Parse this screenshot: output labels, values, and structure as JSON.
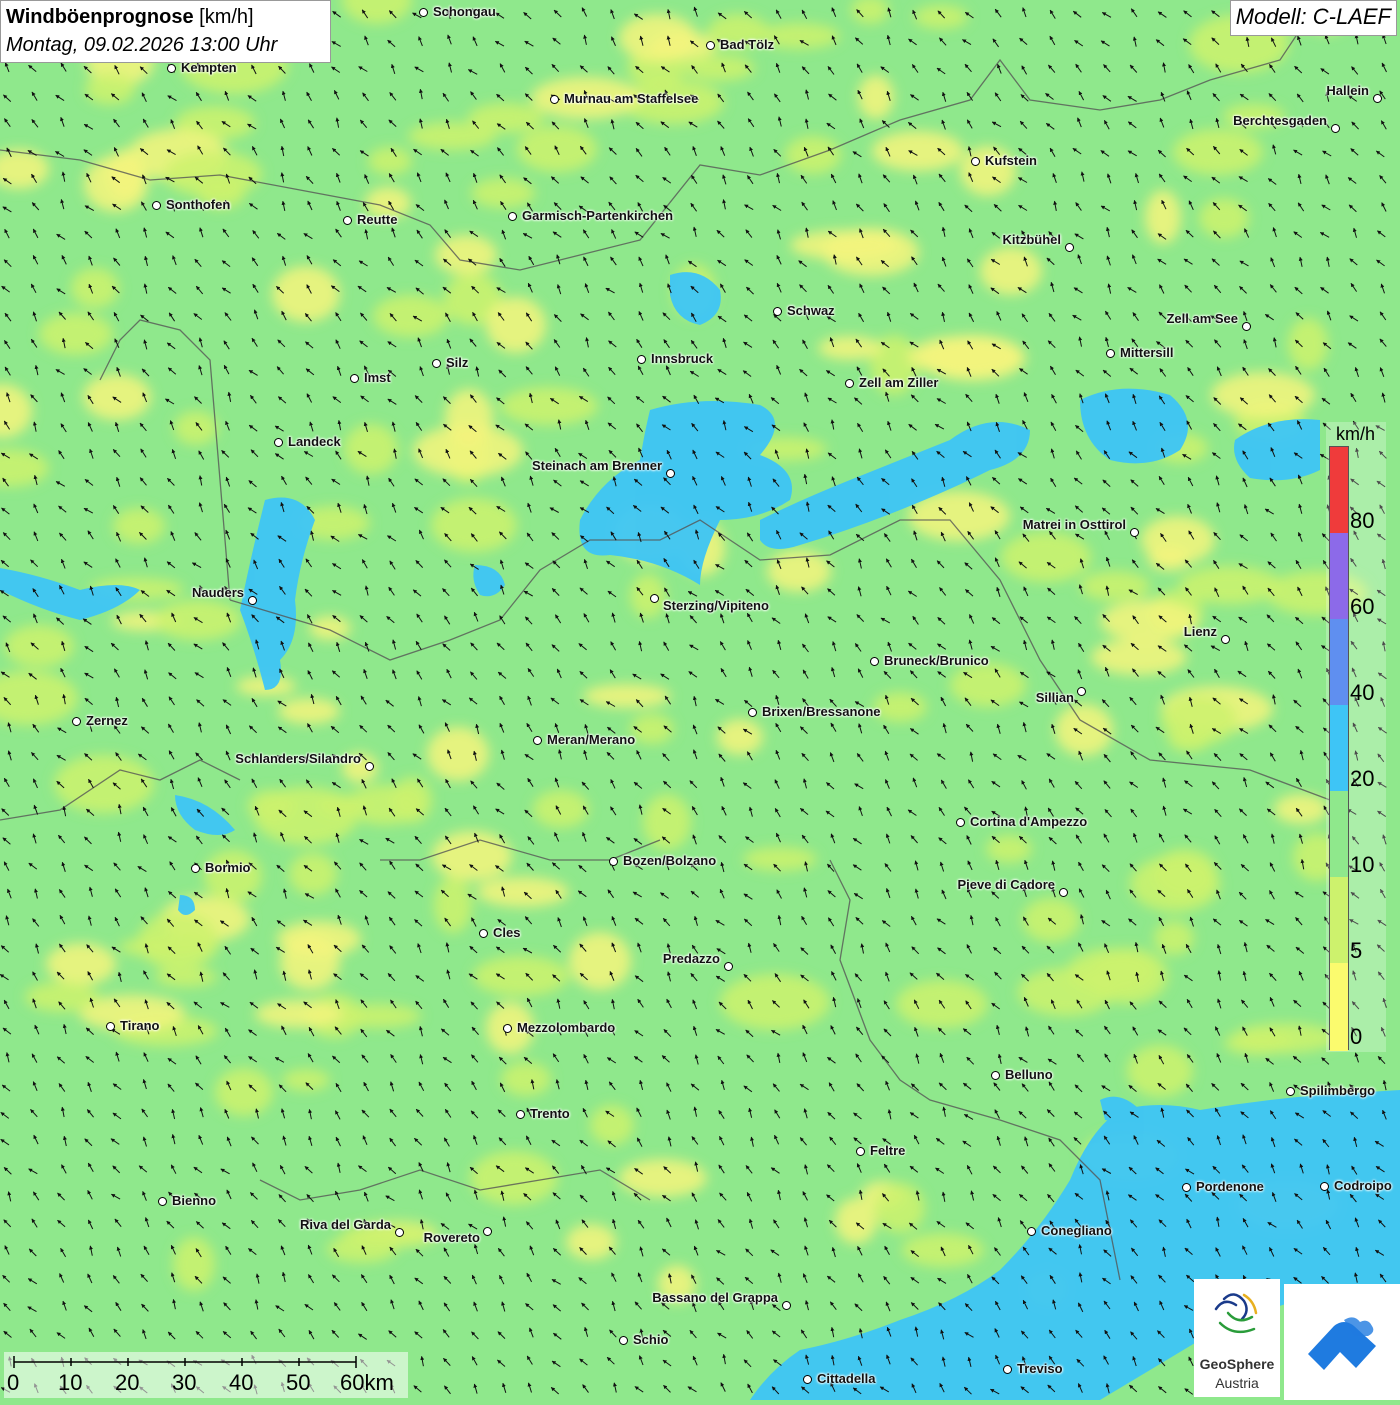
{
  "header": {
    "title_bold": "Windböenprognose",
    "title_unit": "[km/h]",
    "datetime": "Montag, 09.02.2026 13:00 Uhr",
    "model": "Modell: C-LAEF"
  },
  "legend": {
    "unit": "km/h",
    "labels": [
      "80",
      "60",
      "40",
      "20",
      "10",
      "5",
      "0"
    ],
    "colors": {
      "0_5": "#fbfb6e",
      "5_10": "#cdf26d",
      "10_20": "#8fe88c",
      "20_40": "#3ec5f6",
      "40_60": "#5f8ff0",
      "60_80": "#8c6ae9",
      "80_plus": "#ef3b3b"
    }
  },
  "scale_bar": {
    "labels": [
      "0",
      "10",
      "20",
      "30",
      "40",
      "50",
      "60km"
    ]
  },
  "logo": {
    "name": "GeoSphere",
    "sub": "Austria"
  },
  "wind_arrow_direction": "north-west",
  "cities": [
    {
      "name": "Schongau"
    },
    {
      "name": "Bad Tölz"
    },
    {
      "name": "Kempten"
    },
    {
      "name": "Hallein"
    },
    {
      "name": "Murnau am Staffelsee"
    },
    {
      "name": "Berchtesgaden"
    },
    {
      "name": "Kufstein"
    },
    {
      "name": "Sonthofen"
    },
    {
      "name": "Reutte"
    },
    {
      "name": "Garmisch-Partenkirchen"
    },
    {
      "name": "Kitzbühel"
    },
    {
      "name": "Schwaz"
    },
    {
      "name": "Zell am See"
    },
    {
      "name": "Mittersill"
    },
    {
      "name": "Silz"
    },
    {
      "name": "Innsbruck"
    },
    {
      "name": "Imst"
    },
    {
      "name": "Zell am Ziller"
    },
    {
      "name": "Landeck"
    },
    {
      "name": "Steinach am Brenner"
    },
    {
      "name": "Matrei in Osttirol"
    },
    {
      "name": "Nauders"
    },
    {
      "name": "Sterzing/Vipiteno"
    },
    {
      "name": "Lienz"
    },
    {
      "name": "Bruneck/Brunico"
    },
    {
      "name": "Sillian"
    },
    {
      "name": "Brixen/Bressanone"
    },
    {
      "name": "Zernez"
    },
    {
      "name": "Meran/Merano"
    },
    {
      "name": "Schlanders/Silandro"
    },
    {
      "name": "Cortina d'Ampezzo"
    },
    {
      "name": "Bozen/Bolzano"
    },
    {
      "name": "Bormio"
    },
    {
      "name": "Pieve di Cadore"
    },
    {
      "name": "Cles"
    },
    {
      "name": "Predazzo"
    },
    {
      "name": "Tirano"
    },
    {
      "name": "Mezzolombardo"
    },
    {
      "name": "Belluno"
    },
    {
      "name": "Spilimbergo"
    },
    {
      "name": "Trento"
    },
    {
      "name": "Feltre"
    },
    {
      "name": "Bienno"
    },
    {
      "name": "Pordenone"
    },
    {
      "name": "Codroipo"
    },
    {
      "name": "Riva del Garda"
    },
    {
      "name": "Rovereto"
    },
    {
      "name": "Conegliano"
    },
    {
      "name": "Bassano del Grappa"
    },
    {
      "name": "Schio"
    },
    {
      "name": "Treviso"
    },
    {
      "name": "Cittadella"
    }
  ]
}
